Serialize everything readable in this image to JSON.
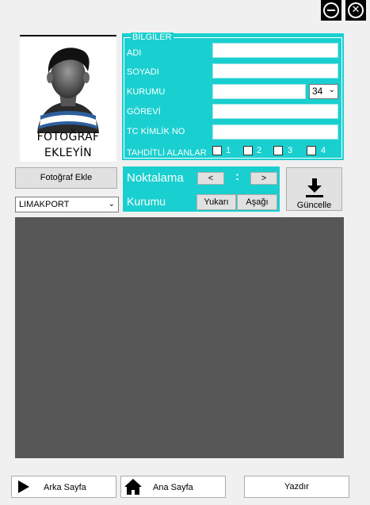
{
  "window": {
    "minimize_icon": "minimize-icon",
    "close_icon": "close-icon"
  },
  "photo": {
    "line1": "FOTOĞRAF",
    "line2": "EKLEYİN"
  },
  "bilgiler": {
    "legend": "BİLGİLER",
    "fields": {
      "adi": {
        "label": "ADI",
        "value": ""
      },
      "soyadi": {
        "label": "SOYADI",
        "value": ""
      },
      "kurumu": {
        "label": "KURUMU",
        "value": "",
        "code": "34"
      },
      "gorevi": {
        "label": "GÖREVİ",
        "value": ""
      },
      "tc": {
        "label": "TC KİMLİK NO",
        "value": ""
      }
    },
    "tahditli": {
      "label": "TAHDİTLİ ALANLAR",
      "options": [
        "1",
        "2",
        "3",
        "4"
      ]
    }
  },
  "buttons": {
    "add_photo": "Fotoğraf Ekle",
    "update": "Güncelle",
    "back": "Arka Sayfa",
    "home": "Ana Sayfa",
    "print": "Yazdır"
  },
  "institution_select": {
    "value": "LIMAKPORT"
  },
  "noktalama": {
    "label": "Noktalama",
    "prev": "<",
    "colon": ":",
    "next": ">",
    "kurumu_label": "Kurumu",
    "up": "Yukarı",
    "down": "Aşağı"
  },
  "colors": {
    "accent": "#19cfcf",
    "preview_bg": "#575757"
  }
}
